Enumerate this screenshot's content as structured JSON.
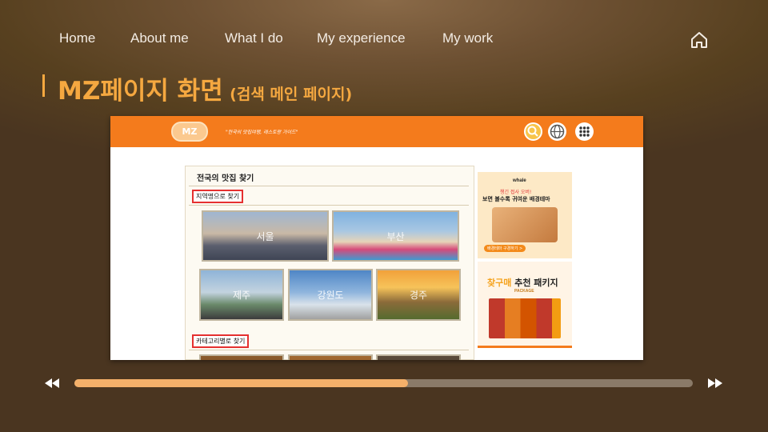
{
  "nav": {
    "items": [
      {
        "label": "Home"
      },
      {
        "label": "About me"
      },
      {
        "label": "What I do"
      },
      {
        "label": "My experience"
      },
      {
        "label": "My work"
      }
    ],
    "home_icon": "home-icon"
  },
  "heading": {
    "title": "MZ페이지 화면",
    "subtitle": "(검색 메인 페이지)",
    "accent_color": "#f5a840"
  },
  "screenshot": {
    "header": {
      "logo": "MZ",
      "tagline": "\"한국의 맛집여행, 레스토랑 가이드\"",
      "icons": [
        "search-icon",
        "globe-icon",
        "apps-grid-icon"
      ],
      "color": "#f47b1c"
    },
    "main": {
      "section_title": "전국의 맛집 찾기",
      "region_label": "지역명으로 찾기",
      "regions": [
        {
          "label": "서울"
        },
        {
          "label": "부산"
        },
        {
          "label": "제주"
        },
        {
          "label": "강원도"
        },
        {
          "label": "경주"
        }
      ],
      "category_label": "카테고리별로 찾기"
    },
    "ads": {
      "ad1": {
        "brand": "whale",
        "red_text": "챙긴 접사 오버!",
        "title": "보면 볼수록 귀여운 배경테마",
        "button": "배경테마 구경하기 >"
      },
      "ad2": {
        "title_highlight": "찾구매",
        "title_rest": " 추천 패키지",
        "subtitle": "PACKAGE"
      }
    }
  },
  "player": {
    "progress": 0.54,
    "prev_icon": "rewind-icon",
    "next_icon": "fast-forward-icon"
  }
}
